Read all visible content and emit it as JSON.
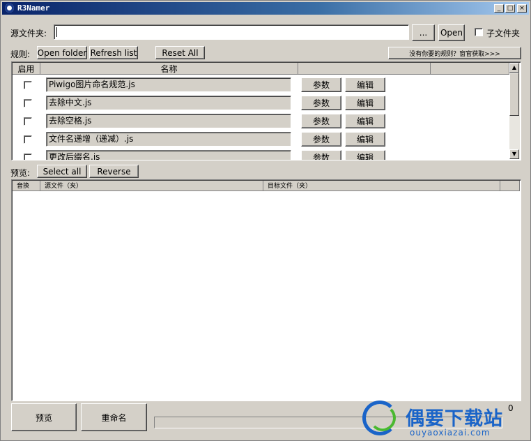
{
  "window": {
    "title": "R3Namer",
    "min": "_",
    "max": "□",
    "close": "×"
  },
  "source": {
    "label": "源文件夹:",
    "path": "",
    "browse_label": "...",
    "open_label": "Open",
    "subfolder_label": "子文件夹"
  },
  "rules": {
    "label": "规则:",
    "open_folder": "Open folder",
    "refresh_list": "Refresh list",
    "reset_all": "Reset All",
    "get_more": "没有你要的规则？窗官获取>>>",
    "headers": {
      "enabled": "启用",
      "name": "名称"
    },
    "param_label": "参数",
    "edit_label": "编辑",
    "items": [
      {
        "name": "Piwigo图片命名规范.js"
      },
      {
        "name": "去除中文.js"
      },
      {
        "name": "去除空格.js"
      },
      {
        "name": "文件名递增（递减）.js"
      },
      {
        "name": "更改后缀名.js"
      }
    ]
  },
  "preview": {
    "label": "预览:",
    "select_all": "Select all",
    "reverse": "Reverse",
    "headers": {
      "index": "音换",
      "source": "源文件（夹）",
      "target": "目标文件（夹）"
    }
  },
  "footer": {
    "preview_btn": "预览",
    "rename_btn": "重命名",
    "corner_text": "0"
  },
  "watermark": {
    "name": "偶要下载站",
    "url": "ouyaoxiazai.com"
  },
  "colors": {
    "titlebar": "#0a246a",
    "face": "#d4d0c8",
    "logo_blue": "#1a64c8",
    "logo_green": "#4ab830"
  }
}
